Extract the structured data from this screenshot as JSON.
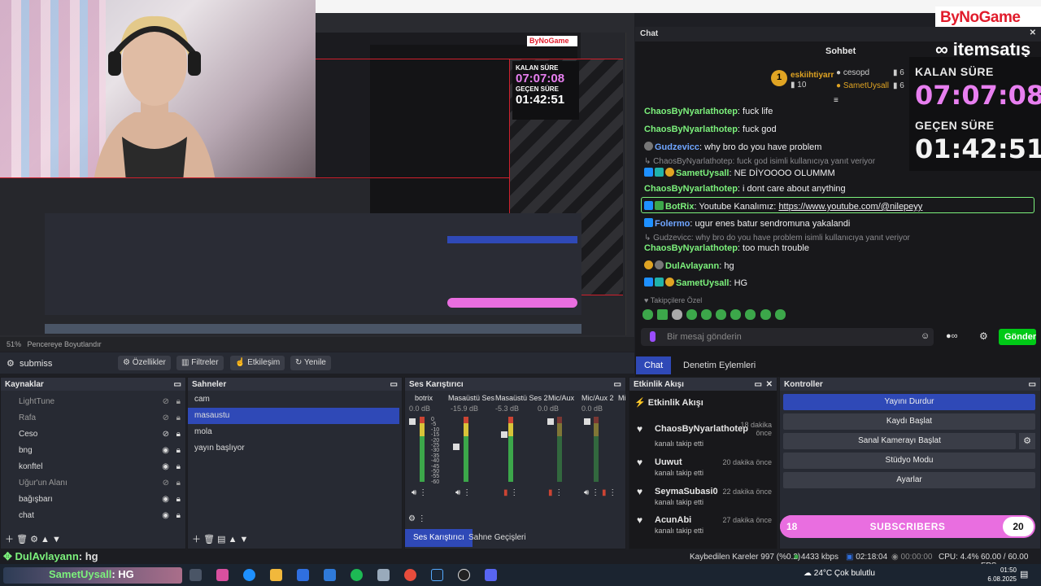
{
  "brand": {
    "bynogame": "ByNoGame",
    "itemsatis": "itemsatış"
  },
  "chat": {
    "panel_title": "Chat",
    "header": "Sohbet",
    "top_users": {
      "first": "eskiihtiyarr",
      "first_count": "10",
      "second": "cesopd",
      "second_count": "6",
      "third": "SametUysall",
      "third_count": "6"
    },
    "messages": [
      {
        "user": "ChaosByNyarlathotep",
        "text": "fuck life"
      },
      {
        "user": "ChaosByNyarlathotep",
        "text": "fuck god"
      },
      {
        "user": "Gudzevicc",
        "text": "why bro do you have problem"
      },
      {
        "reply_note": "ChaosByNyarlathotep: fuck god isimli kullanıcıya yanıt veriyor"
      },
      {
        "user": "SametUysall",
        "text": "NE DİYOOOO OLUMMM"
      },
      {
        "user": "ChaosByNyarlathotep",
        "text": "i dont care about anything"
      },
      {
        "user": "BotRix",
        "text": "Youtube Kanalımız: ",
        "link": "https://www.youtube.com/@nilepeyy"
      },
      {
        "user": "Folermo",
        "text": "ugur enes batur sendromuna yakalandi"
      },
      {
        "reply_note": "Gudzevicc: why bro do you have problem isimli kullanıcıya yanıt veriyor"
      },
      {
        "user": "ChaosByNyarlathotep",
        "text": "too much trouble"
      },
      {
        "user": "DulAvlayann",
        "text": "hg"
      },
      {
        "user": "SametUysall",
        "text": "HG"
      }
    ],
    "followers_only": "Takipçilere Özel",
    "input_placeholder": "Bir mesaj gönderin",
    "send_label": "Gönder",
    "tab_chat": "Chat",
    "tab_moderation": "Denetim Eylemleri"
  },
  "timers": {
    "remaining_label": "KALAN SÜRE",
    "remaining": "07:07:08",
    "elapsed_label": "GEÇEN SÜRE",
    "elapsed": "01:42:51"
  },
  "preview": {
    "zoom": "51%",
    "mode": "Pencereye Boyutlandır"
  },
  "source_toolbar": {
    "source": "submiss",
    "properties": "Özellikler",
    "filters": "Filtreler",
    "interact": "Etkileşim",
    "refresh": "Yenile"
  },
  "sources": {
    "title": "Kaynaklar",
    "items": [
      "LightTune",
      "Rafa",
      "Ceso",
      "bng",
      "konftel",
      "Uğur'un Alanı",
      "bağışbarı",
      "chat"
    ]
  },
  "scenes": {
    "title": "Sahneler",
    "items": [
      "cam",
      "masaustu",
      "mola",
      "yayın başlıyor"
    ],
    "selected": "masaustu"
  },
  "mixer": {
    "title": "Ses Karıştırıcı",
    "channels": [
      {
        "name": "botrix",
        "db": "0.0 dB"
      },
      {
        "name": "Masaüstü Ses",
        "db": "-15.9 dB"
      },
      {
        "name": "Masaüstü Ses 2",
        "db": "-5.3 dB"
      },
      {
        "name": "Mic/Aux",
        "db": "0.0 dB"
      },
      {
        "name": "Mic/Aux 2",
        "db": "0.0 dB"
      },
      {
        "name": "Mi",
        "db": ""
      }
    ],
    "scale": [
      "0",
      "-5",
      "-10",
      "-15",
      "-20",
      "-25",
      "-30",
      "-35",
      "-40",
      "-45",
      "-50",
      "-55",
      "-60"
    ],
    "tab_mixer": "Ses Karıştırıcı",
    "tab_transitions": "Sahne Geçişleri"
  },
  "activity": {
    "title": "Etkinlik Akışı",
    "heading": "Etkinlik Akışı",
    "items": [
      {
        "user": "ChaosByNyarlathotep",
        "action": "kanalı takip etti",
        "time": "18 dakika önce"
      },
      {
        "user": "Uuwut",
        "action": "kanalı takip etti",
        "time": "20 dakika önce"
      },
      {
        "user": "SeymaSubasi0",
        "action": "kanalı takip etti",
        "time": "22 dakika önce"
      },
      {
        "user": "AcunAbi",
        "action": "kanalı takip etti",
        "time": "27 dakika önce"
      }
    ]
  },
  "controls": {
    "title": "Kontroller",
    "stop_stream": "Yayını Durdur",
    "start_record": "Kaydı Başlat",
    "start_virtualcam": "Sanal Kamerayı Başlat",
    "studio_mode": "Stüdyo Modu",
    "settings": "Ayarlar"
  },
  "subscribers": {
    "current": "18",
    "label": "SUBSCRIBERS",
    "goal": "20",
    "progress": 0.9
  },
  "chat_ticker": {
    "user": "DulAvlayann",
    "text": ": hg",
    "user2": "SametUysall",
    "text2": ": HG"
  },
  "status": {
    "dropped": "Kaybedilen Kareler 997 (%0.2)",
    "bitrate": "4433 kbps",
    "stream_time": "02:18:04",
    "rec_time": "00:00:00",
    "cpu": "CPU: 4.4%",
    "fps": "60.00 / 60.00 FPS"
  },
  "taskbar": {
    "weather": "24°C",
    "weather_desc": "Çok bulutlu",
    "time": "01:50",
    "date": "6.08.2025"
  }
}
